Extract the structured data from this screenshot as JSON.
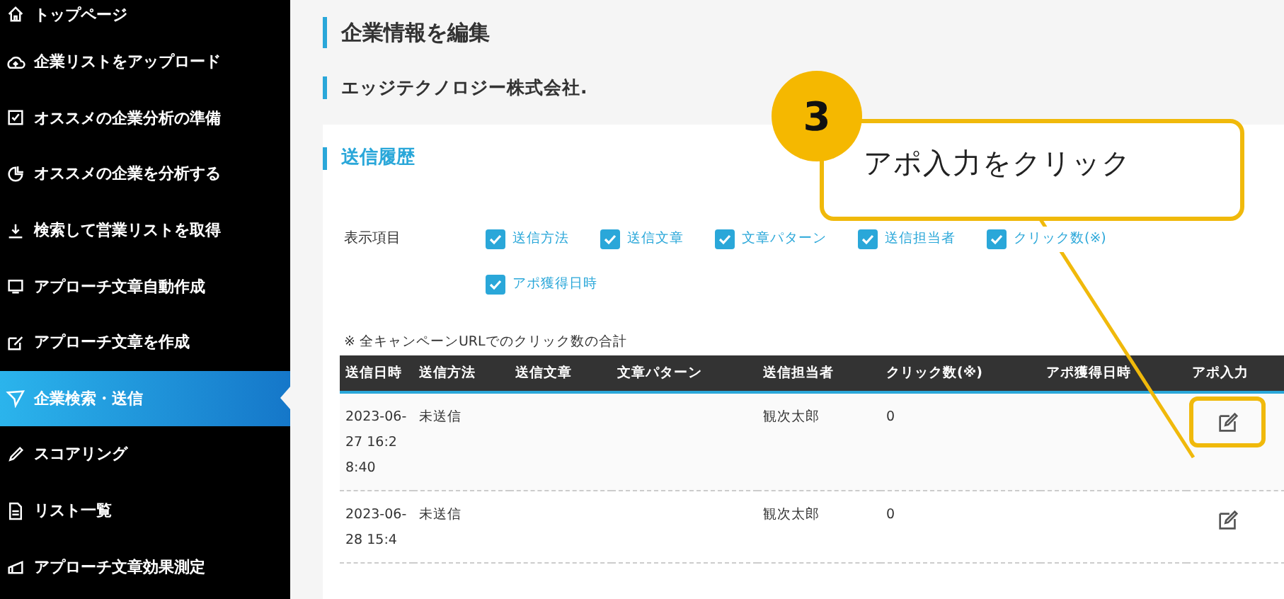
{
  "sidebar": {
    "items": [
      {
        "label": "トップページ",
        "selected": false
      },
      {
        "label": "企業リストをアップロード",
        "selected": false
      },
      {
        "label": "オススメの企業分析の準備",
        "selected": false
      },
      {
        "label": "オススメの企業を分析する",
        "selected": false
      },
      {
        "label": "検索して営業リストを取得",
        "selected": false
      },
      {
        "label": "アプローチ文章自動作成",
        "selected": false
      },
      {
        "label": "アプローチ文章を作成",
        "selected": false
      },
      {
        "label": "企業検索・送信",
        "selected": true
      },
      {
        "label": "スコアリング",
        "selected": false
      },
      {
        "label": "リスト一覧",
        "selected": false
      },
      {
        "label": "アプローチ文章効果測定",
        "selected": false
      }
    ]
  },
  "page_title": "企業情報を編集",
  "company": "エッジテクノロジー株式会社.",
  "section_title": "送信履歴",
  "display_items": {
    "label": "表示項目",
    "options": [
      {
        "label": "送信方法",
        "checked": true
      },
      {
        "label": "送信文章",
        "checked": true
      },
      {
        "label": "文章パターン",
        "checked": true
      },
      {
        "label": "送信担当者",
        "checked": true
      },
      {
        "label": "クリック数(※)",
        "checked": true
      },
      {
        "label": "アポ獲得日時",
        "checked": true
      }
    ]
  },
  "note": "※ 全キャンペーンURLでのクリック数の合計",
  "table": {
    "columns": [
      "送信日時",
      "送信方法",
      "送信文章",
      "文章パターン",
      "送信担当者",
      "クリック数(※)",
      "アポ獲得日時",
      "アポ入力"
    ],
    "rows": [
      {
        "cells": [
          "2023-06-27 16:28:40",
          "未送信",
          "",
          "",
          "観次太郎",
          "0",
          ""
        ],
        "highlighted": true
      },
      {
        "cells": [
          "2023-06-28 15:4",
          "未送信",
          "",
          "",
          "観次太郎",
          "0",
          ""
        ],
        "highlighted": false
      }
    ]
  },
  "annotation": {
    "number": "3",
    "text": "アポ入力をクリック"
  }
}
